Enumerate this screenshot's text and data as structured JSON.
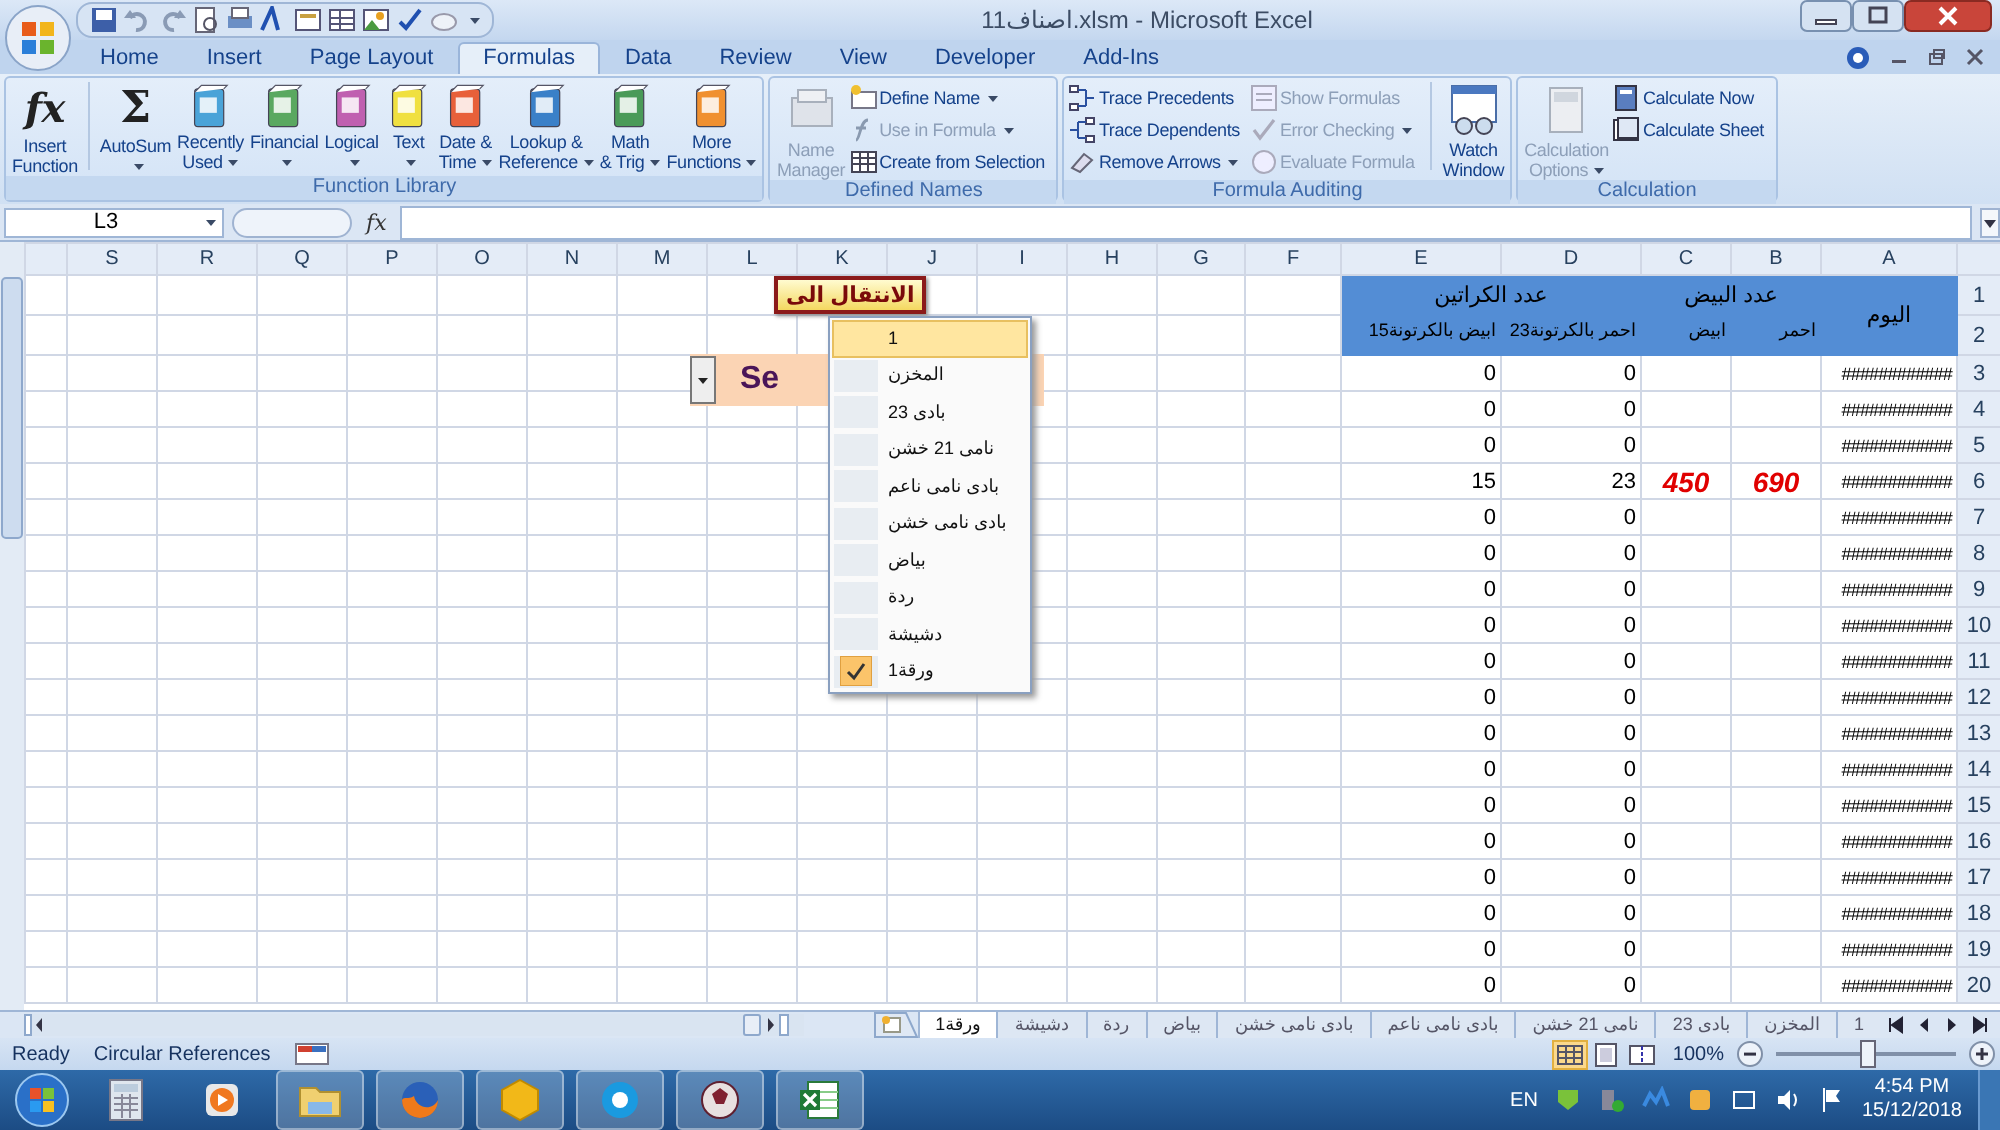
{
  "window": {
    "title": "اصناف11.xlsm - Microsoft Excel"
  },
  "ribbon_tabs": [
    {
      "label": "Home",
      "selected": false
    },
    {
      "label": "Insert",
      "selected": false
    },
    {
      "label": "Page Layout",
      "selected": false
    },
    {
      "label": "Formulas",
      "selected": true
    },
    {
      "label": "Data",
      "selected": false
    },
    {
      "label": "Review",
      "selected": false
    },
    {
      "label": "View",
      "selected": false
    },
    {
      "label": "Developer",
      "selected": false
    },
    {
      "label": "Add-Ins",
      "selected": false
    }
  ],
  "ribbon_groups": [
    {
      "label": "Function Library",
      "items": [
        {
          "kind": "large",
          "lines": [
            "Insert",
            "Function"
          ],
          "glyph": "fx",
          "dropdown": false,
          "disabled": false
        },
        {
          "kind": "large",
          "lines": [
            "AutoSum"
          ],
          "glyph": "Σ",
          "dropdown": true,
          "disabled": false
        },
        {
          "kind": "large",
          "lines": [
            "Recently",
            "Used"
          ],
          "dropdown": true,
          "disabled": false
        },
        {
          "kind": "large",
          "lines": [
            "Financial"
          ],
          "dropdown": true,
          "disabled": false
        },
        {
          "kind": "large",
          "lines": [
            "Logical"
          ],
          "dropdown": true,
          "disabled": false
        },
        {
          "kind": "large",
          "lines": [
            "Text"
          ],
          "dropdown": true,
          "disabled": false
        },
        {
          "kind": "large",
          "lines": [
            "Date &",
            "Time"
          ],
          "dropdown": true,
          "disabled": false
        },
        {
          "kind": "large",
          "lines": [
            "Lookup &",
            "Reference"
          ],
          "dropdown": true,
          "disabled": false
        },
        {
          "kind": "large",
          "lines": [
            "Math",
            "& Trig"
          ],
          "dropdown": true,
          "disabled": false
        },
        {
          "kind": "large",
          "lines": [
            "More",
            "Functions"
          ],
          "dropdown": true,
          "disabled": false
        }
      ]
    },
    {
      "label": "Defined Names",
      "items": [
        {
          "kind": "large",
          "lines": [
            "Name",
            "Manager"
          ],
          "dropdown": false,
          "disabled": true
        },
        {
          "kind": "small",
          "label": "Define Name",
          "dropdown": true,
          "disabled": false
        },
        {
          "kind": "small",
          "label": "Use in Formula",
          "dropdown": true,
          "disabled": true
        },
        {
          "kind": "small",
          "label": "Create from Selection",
          "dropdown": false,
          "disabled": false
        }
      ]
    },
    {
      "label": "Formula Auditing",
      "items": [
        {
          "kind": "small",
          "label": "Trace Precedents",
          "dropdown": false,
          "disabled": false
        },
        {
          "kind": "small",
          "label": "Trace Dependents",
          "dropdown": false,
          "disabled": false
        },
        {
          "kind": "small",
          "label": "Remove Arrows",
          "dropdown": true,
          "disabled": false
        },
        {
          "kind": "small",
          "label": "Show Formulas",
          "dropdown": false,
          "disabled": true
        },
        {
          "kind": "small",
          "label": "Error Checking",
          "dropdown": true,
          "disabled": true
        },
        {
          "kind": "small",
          "label": "Evaluate Formula",
          "dropdown": false,
          "disabled": true
        },
        {
          "kind": "large",
          "lines": [
            "Watch",
            "Window"
          ],
          "dropdown": false,
          "disabled": false
        }
      ]
    },
    {
      "label": "Calculation",
      "items": [
        {
          "kind": "large",
          "lines": [
            "Calculation",
            "Options"
          ],
          "dropdown": true,
          "disabled": true
        },
        {
          "kind": "small",
          "label": "Calculate Now",
          "dropdown": false,
          "disabled": false
        },
        {
          "kind": "small",
          "label": "Calculate Sheet",
          "dropdown": false,
          "disabled": false
        }
      ]
    }
  ],
  "formula_bar": {
    "name_box": "L3",
    "fx_label": "fx"
  },
  "sheet": {
    "columns": [
      "S",
      "R",
      "Q",
      "P",
      "O",
      "N",
      "M",
      "L",
      "K",
      "J",
      "I",
      "H",
      "G",
      "F",
      "E",
      "D",
      "C",
      "B",
      "A"
    ],
    "header": {
      "row_numbers": [
        "1",
        "2"
      ],
      "date_label": "اليوم",
      "groups": [
        {
          "label": "عدد البيض",
          "subs": [
            "احمر",
            "ابيض"
          ]
        },
        {
          "label": "عدد الكراتين",
          "subs": [
            "23احمر بالكرتونة",
            "15ابيض بالكرتونة"
          ]
        }
      ]
    },
    "rows": [
      {
        "number": "3",
        "cells": {
          "A": "############",
          "D": "0",
          "E": "0"
        }
      },
      {
        "number": "4",
        "cells": {
          "A": "############",
          "D": "0",
          "E": "0"
        }
      },
      {
        "number": "5",
        "cells": {
          "A": "############",
          "D": "0",
          "E": "0"
        }
      },
      {
        "number": "6",
        "cells": {
          "A": "############",
          "B": "690",
          "C": "450",
          "D": "23",
          "E": "15"
        }
      },
      {
        "number": "7",
        "cells": {
          "A": "############",
          "D": "0",
          "E": "0"
        }
      },
      {
        "number": "8",
        "cells": {
          "A": "############",
          "D": "0",
          "E": "0"
        }
      },
      {
        "number": "9",
        "cells": {
          "A": "############",
          "D": "0",
          "E": "0"
        }
      },
      {
        "number": "10",
        "cells": {
          "A": "############",
          "D": "0",
          "E": "0"
        }
      },
      {
        "number": "11",
        "cells": {
          "A": "############",
          "D": "0",
          "E": "0"
        }
      },
      {
        "number": "12",
        "cells": {
          "A": "############",
          "D": "0",
          "E": "0"
        }
      },
      {
        "number": "13",
        "cells": {
          "A": "############",
          "D": "0",
          "E": "0"
        }
      },
      {
        "number": "14",
        "cells": {
          "A": "############",
          "D": "0",
          "E": "0"
        }
      },
      {
        "number": "15",
        "cells": {
          "A": "############",
          "D": "0",
          "E": "0"
        }
      },
      {
        "number": "16",
        "cells": {
          "A": "############",
          "D": "0",
          "E": "0"
        }
      },
      {
        "number": "17",
        "cells": {
          "A": "############",
          "D": "0",
          "E": "0"
        }
      },
      {
        "number": "18",
        "cells": {
          "A": "############",
          "D": "0",
          "E": "0"
        }
      },
      {
        "number": "19",
        "cells": {
          "A": "############",
          "D": "0",
          "E": "0"
        }
      },
      {
        "number": "20",
        "cells": {
          "A": "############",
          "D": "0",
          "E": "0"
        }
      }
    ]
  },
  "controls": {
    "goto_button": {
      "label": "الانتقال الى"
    },
    "sheet_combo": {
      "value": "Se"
    },
    "sheet_menu": {
      "items": [
        {
          "label": "1",
          "selected": true,
          "checked": false
        },
        {
          "label": "المخزن",
          "selected": false,
          "checked": false
        },
        {
          "label": "بادى 23",
          "selected": false,
          "checked": false
        },
        {
          "label": "نامى 21 خشن",
          "selected": false,
          "checked": false
        },
        {
          "label": "بادى نامى  ناعم",
          "selected": false,
          "checked": false
        },
        {
          "label": "بادى نامى خشن",
          "selected": false,
          "checked": false
        },
        {
          "label": "بياض",
          "selected": false,
          "checked": false
        },
        {
          "label": "ردة",
          "selected": false,
          "checked": false
        },
        {
          "label": "دشيشة",
          "selected": false,
          "checked": false
        },
        {
          "label": "ورقة1",
          "selected": false,
          "checked": true
        }
      ]
    }
  },
  "sheet_tabs": [
    {
      "label": "1",
      "selected": false
    },
    {
      "label": "المخزن",
      "selected": false
    },
    {
      "label": "بادى 23",
      "selected": false
    },
    {
      "label": "نامى 21 خشن",
      "selected": false
    },
    {
      "label": "بادى نامى  ناعم",
      "selected": false
    },
    {
      "label": "بادى نامى خشن",
      "selected": false
    },
    {
      "label": "بياض",
      "selected": false
    },
    {
      "label": "ردة",
      "selected": false
    },
    {
      "label": "دشيشة",
      "selected": false
    },
    {
      "label": "ورقة1",
      "selected": true
    }
  ],
  "status_bar": {
    "items": [
      "Ready",
      "Circular References"
    ],
    "view_buttons": [
      {
        "selected": true
      },
      {
        "selected": false
      },
      {
        "selected": false
      }
    ],
    "zoom": {
      "label": "100%",
      "level": 0.5
    }
  },
  "taskbar": {
    "language": "EN",
    "time": "4:54 PM",
    "date": "15/12/2018"
  }
}
